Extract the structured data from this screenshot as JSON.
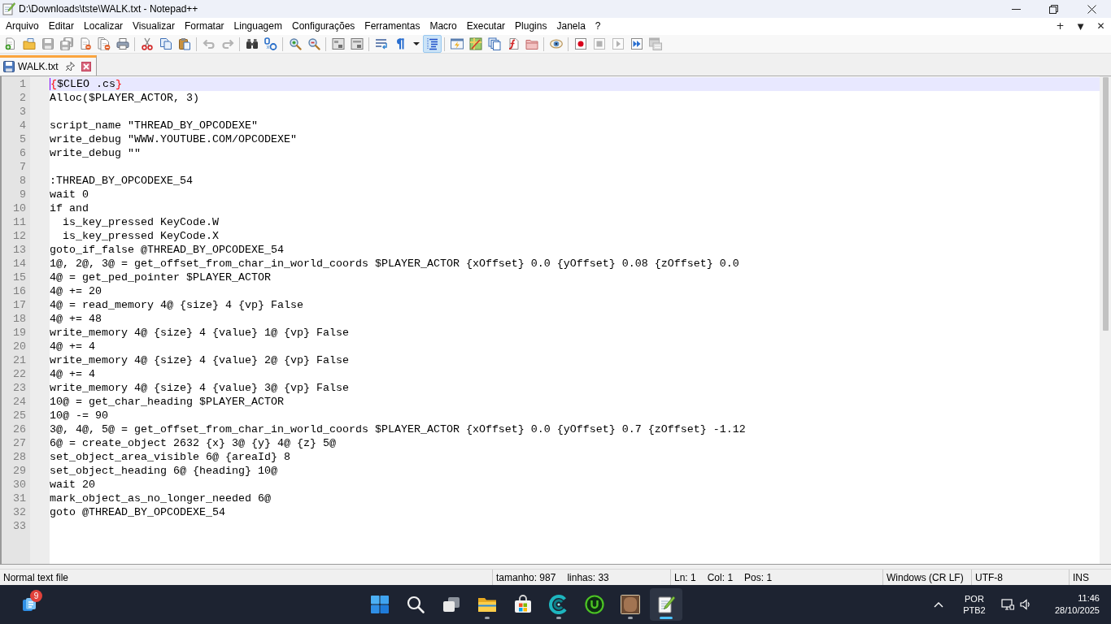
{
  "window": {
    "title": "D:\\Downloads\\tste\\WALK.txt - Notepad++"
  },
  "menu_bar": {
    "items": [
      "Arquivo",
      "Editar",
      "Localizar",
      "Visualizar",
      "Formatar",
      "Linguagem",
      "Configurações",
      "Ferramentas",
      "Macro",
      "Executar",
      "Plugins",
      "Janela",
      "?"
    ],
    "right_controls": [
      {
        "kind": "new-tab",
        "label": "+"
      },
      {
        "kind": "tab-list",
        "label": "▼"
      },
      {
        "kind": "close",
        "label": "✕"
      }
    ]
  },
  "toolbar": {
    "groups": [
      [
        {
          "kind": "new",
          "disabled": false,
          "on": false
        },
        {
          "kind": "open",
          "disabled": false,
          "on": false
        },
        {
          "kind": "save",
          "disabled": true,
          "on": false
        },
        {
          "kind": "save-all",
          "disabled": true,
          "on": false
        },
        {
          "kind": "close",
          "disabled": false,
          "on": false
        },
        {
          "kind": "close-all",
          "disabled": false,
          "on": false
        },
        {
          "kind": "print",
          "disabled": false,
          "on": false
        }
      ],
      [
        {
          "kind": "cut",
          "disabled": false,
          "on": false
        },
        {
          "kind": "copy",
          "disabled": false,
          "on": false
        },
        {
          "kind": "paste",
          "disabled": false,
          "on": false
        }
      ],
      [
        {
          "kind": "undo",
          "disabled": true,
          "on": false
        },
        {
          "kind": "redo",
          "disabled": true,
          "on": false
        }
      ],
      [
        {
          "kind": "find",
          "disabled": false,
          "on": false
        },
        {
          "kind": "replace",
          "disabled": false,
          "on": false
        }
      ],
      [
        {
          "kind": "zoom-in",
          "disabled": false,
          "on": false
        },
        {
          "kind": "zoom-out",
          "disabled": false,
          "on": false
        }
      ],
      [
        {
          "kind": "sync-vertical",
          "disabled": false,
          "on": false
        },
        {
          "kind": "sync-horizontal",
          "disabled": false,
          "on": false
        }
      ],
      [
        {
          "kind": "word-wrap",
          "disabled": false,
          "on": false
        },
        {
          "kind": "show-all-chars",
          "disabled": false,
          "on": false
        },
        {
          "kind": "dropdown",
          "disabled": false,
          "on": false
        },
        {
          "kind": "indent-guide",
          "disabled": false,
          "on": true
        }
      ],
      [
        {
          "kind": "user-language",
          "disabled": false,
          "on": false
        },
        {
          "kind": "document-map",
          "disabled": false,
          "on": false
        },
        {
          "kind": "document-list",
          "disabled": false,
          "on": false
        },
        {
          "kind": "function-list",
          "disabled": false,
          "on": false
        },
        {
          "kind": "folder-workspace",
          "disabled": false,
          "on": false
        }
      ],
      [
        {
          "kind": "monitoring",
          "disabled": false,
          "on": false
        }
      ],
      [
        {
          "kind": "record",
          "disabled": false,
          "on": false
        },
        {
          "kind": "stop",
          "disabled": true,
          "on": false
        },
        {
          "kind": "play",
          "disabled": true,
          "on": false
        },
        {
          "kind": "play-multiple",
          "disabled": false,
          "on": false
        },
        {
          "kind": "save-macro",
          "disabled": true,
          "on": false
        }
      ]
    ]
  },
  "tabs": [
    {
      "label": "WALK.txt",
      "selected": true
    }
  ],
  "editor": {
    "lines": [
      {
        "number": "1",
        "current": true,
        "segments": [
          {
            "kind": "brace",
            "text": "{"
          },
          {
            "kind": "plain",
            "text": "$CLEO .cs"
          },
          {
            "kind": "brace",
            "text": "}"
          }
        ]
      },
      {
        "number": "2",
        "current": false,
        "text": "Alloc($PLAYER_ACTOR, 3)"
      },
      {
        "number": "3",
        "current": false
      },
      {
        "number": "4",
        "current": false,
        "text": "script_name \"THREAD_BY_OPCODEXE\""
      },
      {
        "number": "5",
        "current": false,
        "text": "write_debug \"WWW.YOUTUBE.COM/OPCODEXE\""
      },
      {
        "number": "6",
        "current": false,
        "text": "write_debug \"\""
      },
      {
        "number": "7",
        "current": false
      },
      {
        "number": "8",
        "current": false,
        "text": ":THREAD_BY_OPCODEXE_54"
      },
      {
        "number": "9",
        "current": false,
        "text": "wait 0"
      },
      {
        "number": "10",
        "current": false,
        "text": "if and"
      },
      {
        "number": "11",
        "current": false,
        "text": "  is_key_pressed KeyCode.W"
      },
      {
        "number": "12",
        "current": false,
        "text": "  is_key_pressed KeyCode.X"
      },
      {
        "number": "13",
        "current": false,
        "text": "goto_if_false @THREAD_BY_OPCODEXE_54"
      },
      {
        "number": "14",
        "current": false,
        "text": "1@, 2@, 3@ = get_offset_from_char_in_world_coords $PLAYER_ACTOR {xOffset} 0.0 {yOffset} 0.08 {zOffset} 0.0"
      },
      {
        "number": "15",
        "current": false,
        "text": "4@ = get_ped_pointer $PLAYER_ACTOR"
      },
      {
        "number": "16",
        "current": false,
        "text": "4@ += 20"
      },
      {
        "number": "17",
        "current": false,
        "text": "4@ = read_memory 4@ {size} 4 {vp} False"
      },
      {
        "number": "18",
        "current": false,
        "text": "4@ += 48"
      },
      {
        "number": "19",
        "current": false,
        "text": "write_memory 4@ {size} 4 {value} 1@ {vp} False"
      },
      {
        "number": "20",
        "current": false,
        "text": "4@ += 4"
      },
      {
        "number": "21",
        "current": false,
        "text": "write_memory 4@ {size} 4 {value} 2@ {vp} False"
      },
      {
        "number": "22",
        "current": false,
        "text": "4@ += 4"
      },
      {
        "number": "23",
        "current": false,
        "text": "write_memory 4@ {size} 4 {value} 3@ {vp} False"
      },
      {
        "number": "24",
        "current": false,
        "text": "10@ = get_char_heading $PLAYER_ACTOR"
      },
      {
        "number": "25",
        "current": false,
        "text": "10@ -= 90"
      },
      {
        "number": "26",
        "current": false,
        "text": "3@, 4@, 5@ = get_offset_from_char_in_world_coords $PLAYER_ACTOR {xOffset} 0.0 {yOffset} 0.7 {zOffset} -1.12"
      },
      {
        "number": "27",
        "current": false,
        "text": "6@ = create_object 2632 {x} 3@ {y} 4@ {z} 5@"
      },
      {
        "number": "28",
        "current": false,
        "text": "set_object_area_visible 6@ {areaId} 8"
      },
      {
        "number": "29",
        "current": false,
        "text": "set_object_heading 6@ {heading} 10@"
      },
      {
        "number": "30",
        "current": false,
        "text": "wait 20"
      },
      {
        "number": "31",
        "current": false,
        "text": "mark_object_as_no_longer_needed 6@"
      },
      {
        "number": "32",
        "current": false,
        "text": "goto @THREAD_BY_OPCODEXE_54"
      },
      {
        "number": "33",
        "current": false
      }
    ]
  },
  "status_bar": {
    "panels": [
      [
        "Normal text file"
      ],
      [
        "tamanho: 987",
        "linhas: 33"
      ],
      [
        "Ln: 1",
        "Col: 1",
        "Pos: 1"
      ],
      [
        "Windows (CR LF)"
      ],
      [
        "UTF-8"
      ],
      [
        "INS"
      ]
    ]
  },
  "taskbar": {
    "widgets": {
      "badge": "9"
    },
    "apps": [
      {
        "kind": "start",
        "running": false,
        "selected": false
      },
      {
        "kind": "search",
        "running": false,
        "selected": false
      },
      {
        "kind": "task-view",
        "running": false,
        "selected": false
      },
      {
        "kind": "file-explorer",
        "running": true,
        "selected": false
      },
      {
        "kind": "store",
        "running": false,
        "selected": false
      },
      {
        "kind": "wave-app",
        "running": true,
        "selected": false
      },
      {
        "kind": "ring-app",
        "running": false,
        "selected": false
      },
      {
        "kind": "picture-app",
        "running": true,
        "selected": false
      },
      {
        "kind": "notepad",
        "running": true,
        "selected": true
      }
    ],
    "tray": {
      "language": "POR",
      "layout": "PTB2",
      "time": "11:46",
      "date": "28/10/2025"
    }
  }
}
